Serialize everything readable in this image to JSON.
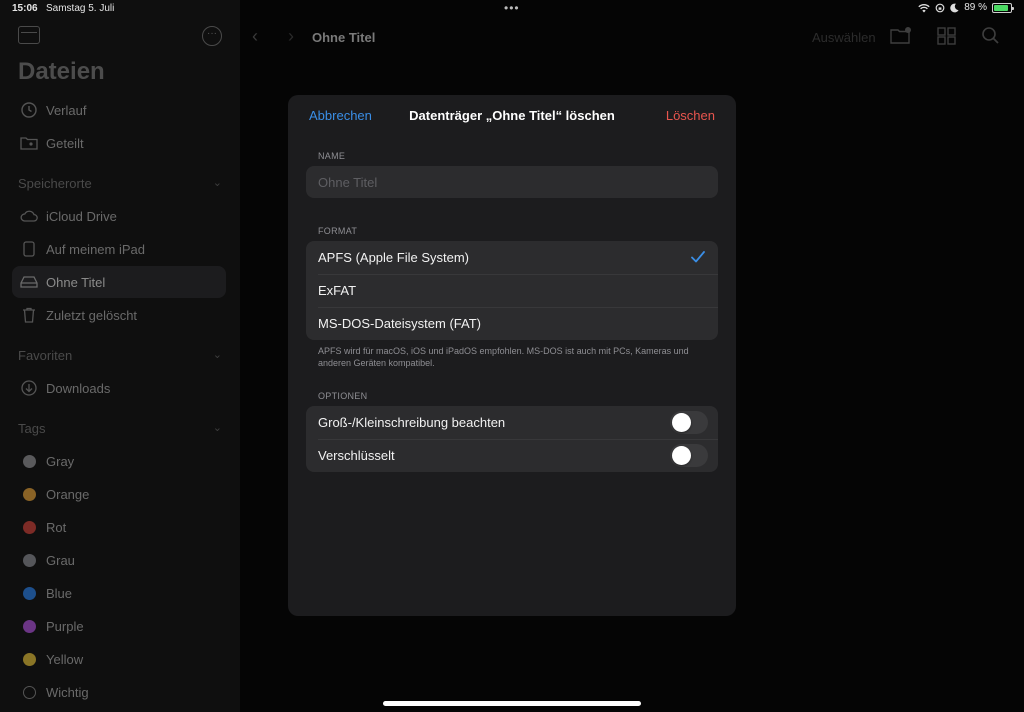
{
  "status_bar": {
    "time": "15:06",
    "date": "Samstag 5. Juli",
    "battery": "89 %",
    "battery_level": 0.89
  },
  "sidebar": {
    "title": "Dateien",
    "top_items": [
      {
        "label": "Verlauf"
      },
      {
        "label": "Geteilt"
      }
    ],
    "locations_header": "Speicherorte",
    "locations": [
      {
        "label": "iCloud Drive"
      },
      {
        "label": "Auf meinem iPad"
      },
      {
        "label": "Ohne Titel"
      },
      {
        "label": "Zuletzt gelöscht"
      }
    ],
    "favorites_header": "Favoriten",
    "favorites": [
      {
        "label": "Downloads"
      }
    ],
    "tags_header": "Tags",
    "tags": [
      {
        "label": "Gray",
        "color": "#5a5a5c"
      },
      {
        "label": "Orange",
        "color": "#8a6326"
      },
      {
        "label": "Rot",
        "color": "#7d2b26"
      },
      {
        "label": "Grau",
        "color": "#55565a"
      },
      {
        "label": "Blue",
        "color": "#1d4f8c"
      },
      {
        "label": "Purple",
        "color": "#6b3585"
      },
      {
        "label": "Yellow",
        "color": "#8a7526"
      },
      {
        "label": "Wichtig",
        "color": "transparent"
      }
    ]
  },
  "main": {
    "folder_title": "Ohne Titel",
    "select_label": "Auswählen"
  },
  "dialog": {
    "cancel_label": "Abbrechen",
    "title": "Datenträger „Ohne Titel“ löschen",
    "erase_label": "Löschen",
    "name_label": "NAME",
    "name_placeholder": "Ohne Titel",
    "format_label": "FORMAT",
    "formats": [
      {
        "label": "APFS (Apple File System)",
        "selected": true
      },
      {
        "label": "ExFAT",
        "selected": false
      },
      {
        "label": "MS-DOS-Dateisystem (FAT)",
        "selected": false
      }
    ],
    "format_note": "APFS wird für macOS, iOS und iPadOS empfohlen. MS-DOS ist auch mit PCs, Kameras und anderen Geräten kompatibel.",
    "options_label": "OPTIONEN",
    "options": [
      {
        "label": "Groß-/Kleinschreibung beachten",
        "on": false
      },
      {
        "label": "Verschlüsselt",
        "on": false
      }
    ]
  },
  "colors": {
    "accent_blue": "#3a8ee6",
    "destructive_red": "#e8554e"
  }
}
